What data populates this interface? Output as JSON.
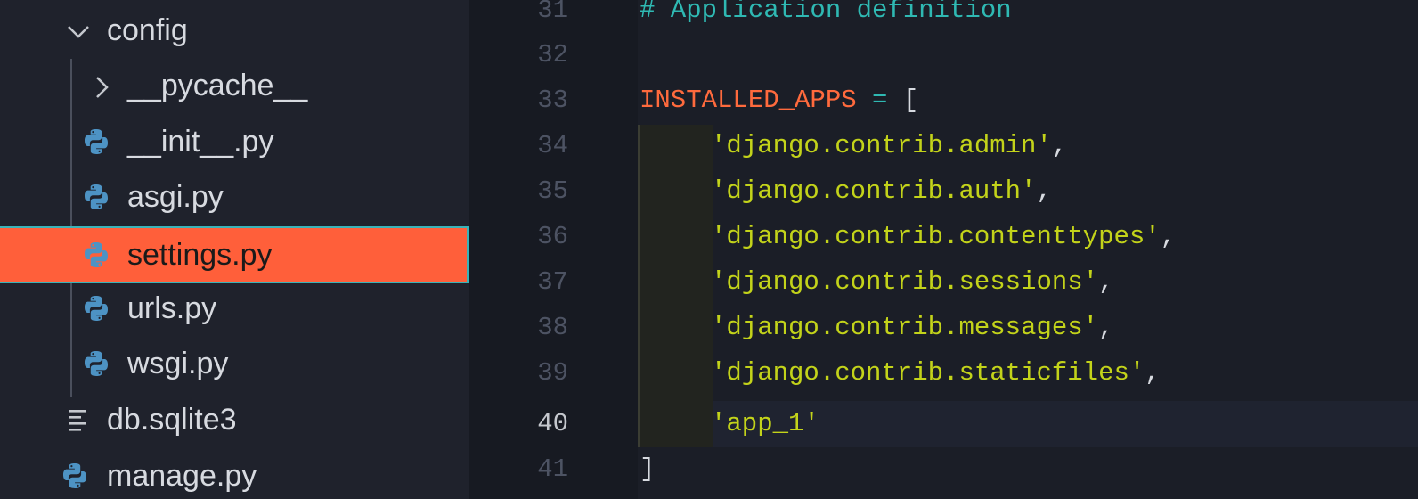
{
  "colors": {
    "sidebar_bg": "#1f222c",
    "selected_bg": "#ff5f3a",
    "selected_border": "#39b3b8",
    "comment": "#2fb9b3",
    "identifier": "#ff6a3d",
    "string": "#c3d31a",
    "python_icon": "#4d93c4"
  },
  "explorer": {
    "items": [
      {
        "label": "config",
        "kind": "folder",
        "expanded": true,
        "icon": "chevron-down-icon"
      },
      {
        "label": "__pycache__",
        "kind": "folder",
        "expanded": false,
        "icon": "chevron-right-icon"
      },
      {
        "label": "__init__.py",
        "kind": "file",
        "icon": "python-file-icon"
      },
      {
        "label": "asgi.py",
        "kind": "file",
        "icon": "python-file-icon"
      },
      {
        "label": "settings.py",
        "kind": "file",
        "icon": "python-file-icon",
        "selected": true
      },
      {
        "label": "urls.py",
        "kind": "file",
        "icon": "python-file-icon"
      },
      {
        "label": "wsgi.py",
        "kind": "file",
        "icon": "python-file-icon"
      },
      {
        "label": "db.sqlite3",
        "kind": "file",
        "icon": "text-file-icon"
      },
      {
        "label": "manage.py",
        "kind": "file",
        "icon": "python-file-icon"
      }
    ]
  },
  "editor": {
    "active_line": "40",
    "lines": [
      {
        "number": "31",
        "comment": "# Application definition"
      },
      {
        "number": "32"
      },
      {
        "number": "33",
        "ident": "INSTALLED_APPS",
        "op": " = ",
        "punc": "["
      },
      {
        "number": "34",
        "str": "'django.contrib.admin'",
        "punc": ","
      },
      {
        "number": "35",
        "str": "'django.contrib.auth'",
        "punc": ","
      },
      {
        "number": "36",
        "str": "'django.contrib.contenttypes'",
        "punc": ","
      },
      {
        "number": "37",
        "str": "'django.contrib.sessions'",
        "punc": ","
      },
      {
        "number": "38",
        "str": "'django.contrib.messages'",
        "punc": ","
      },
      {
        "number": "39",
        "str": "'django.contrib.staticfiles'",
        "punc": ","
      },
      {
        "number": "40",
        "str": "'app_1'"
      },
      {
        "number": "41",
        "punc": "]"
      }
    ]
  }
}
